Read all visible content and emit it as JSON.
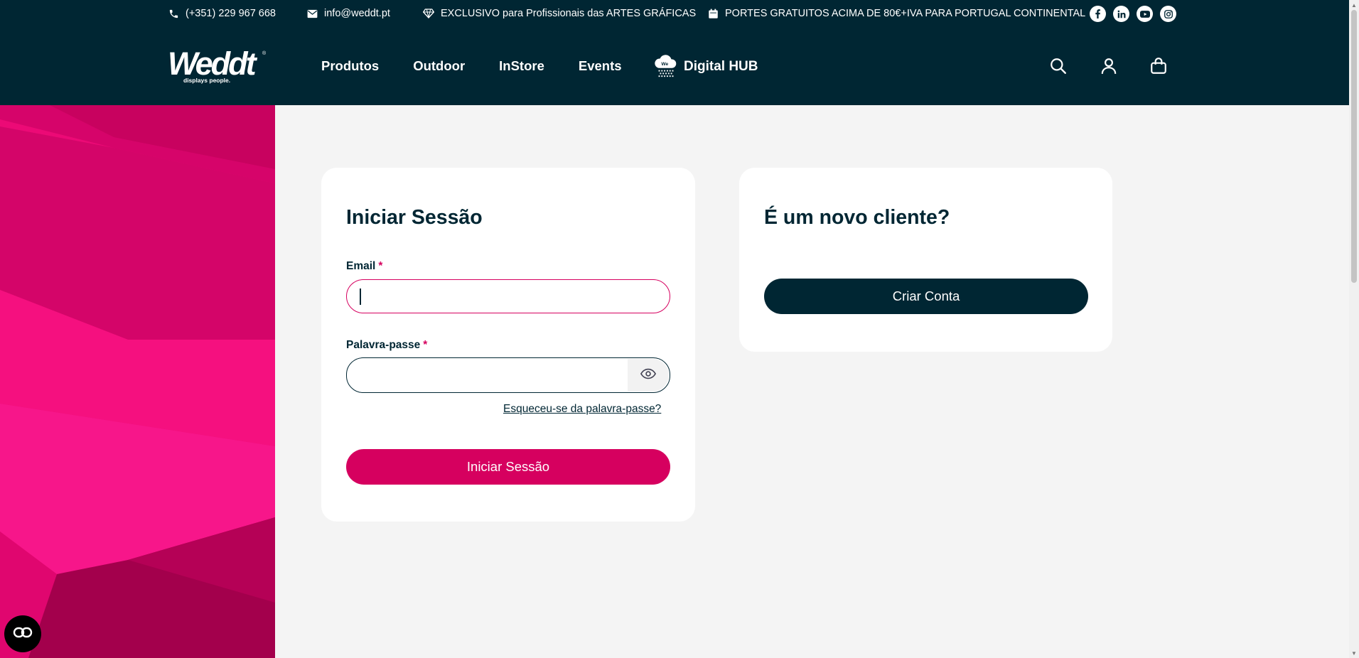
{
  "topbar": {
    "phone": "(+351) 229 967 668",
    "email": "info@weddt.pt",
    "exclusive": "EXCLUSIVO para Profissionais das ARTES GRÁFICAS",
    "shipping": "PORTES GRATUITOS ACIMA DE 80€+IVA PARA PORTUGAL CONTINENTAL",
    "social": [
      "facebook-icon",
      "linkedin-icon",
      "youtube-icon",
      "instagram-icon"
    ]
  },
  "header": {
    "logo_text": "Weddt",
    "logo_tagline": "displays people.",
    "nav": [
      "Produtos",
      "Outdoor",
      "InStore",
      "Events"
    ],
    "hub_label": "Digital HUB",
    "icons": [
      "search-icon",
      "user-icon",
      "cart-icon"
    ]
  },
  "login": {
    "title": "Iniciar Sessão",
    "email_label": "Email",
    "email_value": "",
    "password_label": "Palavra-passe",
    "password_value": "",
    "required_mark": "*",
    "forgot_link": "Esqueceu-se da palavra-passe?",
    "submit_label": "Iniciar Sessão"
  },
  "register": {
    "title": "É um novo cliente?",
    "button_label": "Criar Conta"
  },
  "colors": {
    "brand_dark": "#002633",
    "brand_pink": "#d6005f",
    "background": "#f4f4f4"
  }
}
